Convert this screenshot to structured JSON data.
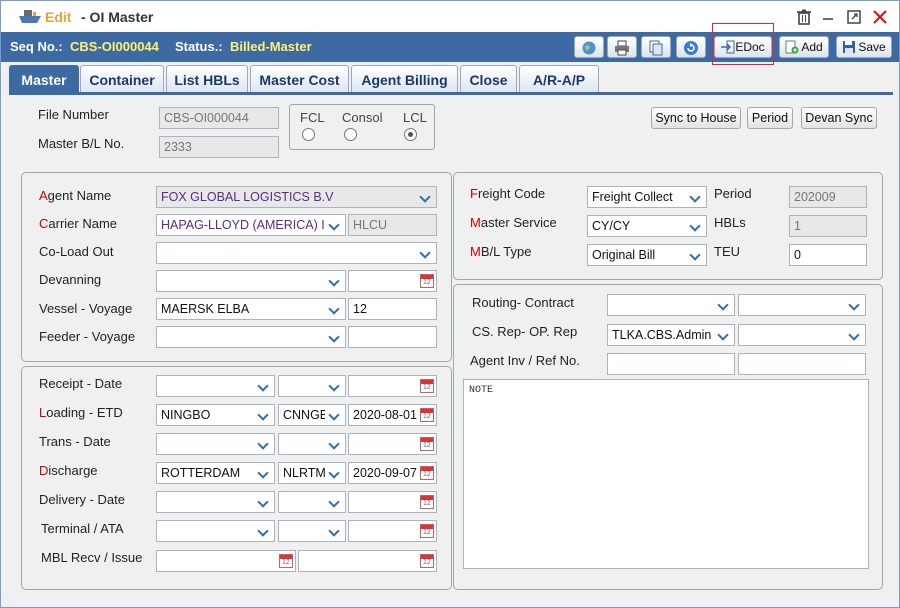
{
  "title": {
    "edit": "Edit",
    "rest": "- OI Master"
  },
  "header": {
    "seq_label": "Seq No.:",
    "seq_value": "CBS-OI000044",
    "status_label": "Status.:",
    "status_value": "Billed-Master"
  },
  "toolbar": {
    "edoc": "EDoc",
    "add": "Add",
    "save": "Save"
  },
  "tabs": [
    "Master",
    "Container",
    "List HBLs",
    "Master Cost",
    "Agent Billing",
    "Close",
    "A/R-A/P"
  ],
  "top": {
    "file_number_label": "File Number",
    "file_number": "CBS-OI000044",
    "mbl_label": "Master B/L No.",
    "mbl": "2333",
    "fcl": "FCL",
    "consol": "Consol",
    "lcl": "LCL",
    "sync_house": "Sync to House",
    "period_btn": "Period",
    "devan_sync": "Devan Sync"
  },
  "left": {
    "agent_label": "Agent Name",
    "agent": "FOX GLOBAL LOGISTICS B.V",
    "carrier_label": "Carrier Name",
    "carrier": "HAPAG-LLOYD (AMERICA) IN",
    "carrier_code": "HLCU",
    "coload_label": "Co-Load Out",
    "devanning_label": "Devanning",
    "vessel_label": "Vessel - Voyage",
    "vessel": "MAERSK ELBA",
    "voyage": "12",
    "feeder_label": "Feeder - Voyage",
    "receipt_label": "Receipt - Date",
    "loading_label": "Loading - ETD",
    "loading": "NINGBO",
    "loading_code": "CNNGB",
    "loading_date": "2020-08-01",
    "trans_label": "Trans - Date",
    "discharge_label": "Discharge",
    "discharge": "ROTTERDAM",
    "discharge_code": "NLRTM",
    "discharge_date": "2020-09-07",
    "delivery_label": "Delivery - Date",
    "terminal_label": "Terminal / ATA",
    "mbl_recv_label": "MBL Recv / Issue"
  },
  "right": {
    "freight_label": "Freight Code",
    "freight": "Freight Collect",
    "period_label": "Period",
    "period": "202009",
    "service_label": "Master Service",
    "service": "CY/CY",
    "hbls_label": "HBLs",
    "hbls": "1",
    "mbl_type_label": "MB/L Type",
    "mbl_type": "Original Bill",
    "teu_label": "TEU",
    "teu": "0",
    "routing_label": "Routing- Contract",
    "csrep_label": "CS. Rep- OP. Rep",
    "csrep": "TLKA.CBS.Admin",
    "agentinv_label": "Agent Inv / Ref No.",
    "note": "NOTE"
  }
}
